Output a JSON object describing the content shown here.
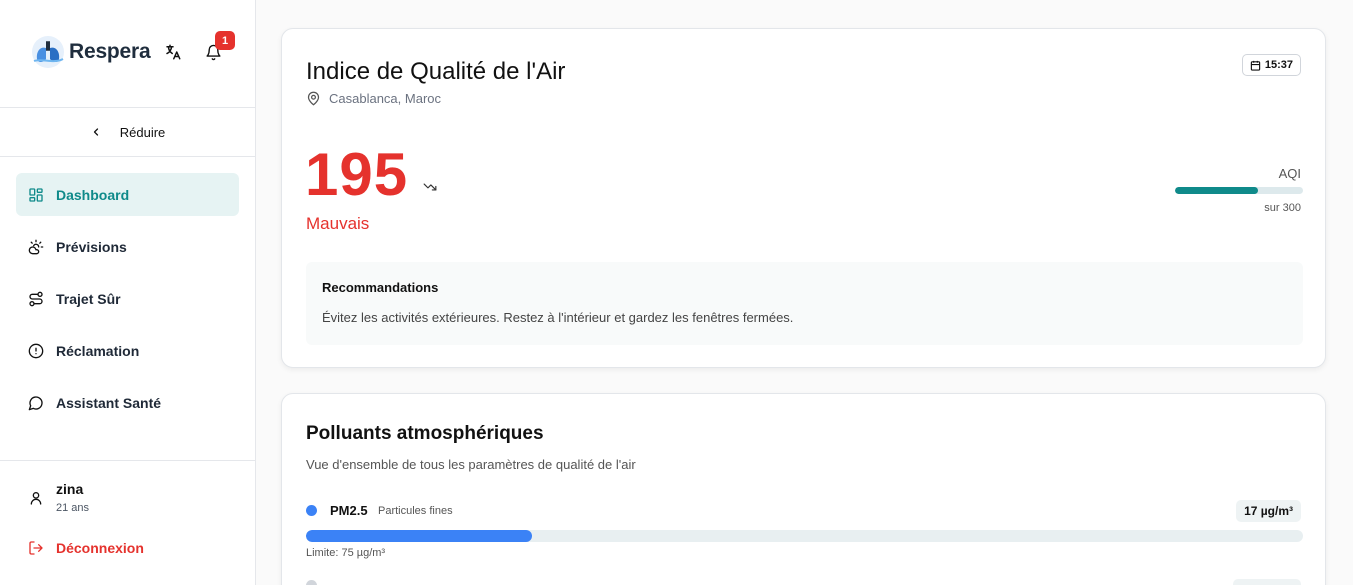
{
  "app": {
    "name": "Respera"
  },
  "notifications": {
    "count": "1"
  },
  "sidebar": {
    "collapse_label": "Réduire",
    "items": [
      {
        "label": "Dashboard",
        "icon": "dashboard-icon",
        "active": true
      },
      {
        "label": "Prévisions",
        "icon": "weather-icon"
      },
      {
        "label": "Trajet Sûr",
        "icon": "route-icon"
      },
      {
        "label": "Réclamation",
        "icon": "alert-circle-icon"
      },
      {
        "label": "Assistant Santé",
        "icon": "chat-icon"
      }
    ],
    "user": {
      "name": "zina",
      "age": "21 ans"
    },
    "logout_label": "Déconnexion"
  },
  "aqi_card": {
    "title": "Indice de Qualité de l'Air",
    "location": "Casablanca, Maroc",
    "time": "15:37",
    "value": "195",
    "status": "Mauvais",
    "scale_label": "AQI",
    "scale_max": "sur 300",
    "fraction": 0.65,
    "recommendations": {
      "title": "Recommandations",
      "text": "Évitez les activités extérieures. Restez à l'intérieur et gardez les fenêtres fermées."
    }
  },
  "pollutants": {
    "title": "Polluants atmosphériques",
    "subtitle": "Vue d'ensemble de tous les paramètres de qualité de l'air",
    "items": [
      {
        "name": "PM2.5",
        "description": "Particules fines",
        "value": "17 µg/m³",
        "limit": "Limite: 75 µg/m³",
        "fraction": 0.227,
        "color": "#3b82f6"
      }
    ]
  },
  "colors": {
    "accent": "#0f8a8a",
    "danger": "#e5322d",
    "pm25": "#3b82f6"
  }
}
